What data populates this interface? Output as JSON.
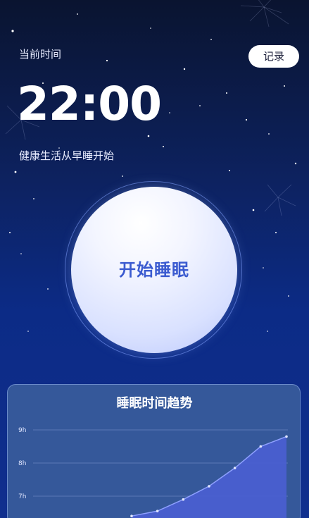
{
  "header": {
    "current_time_label": "当前时间",
    "record_button_label": "记录"
  },
  "clock": {
    "time": "22:00"
  },
  "slogan": "健康生活从早睡开始",
  "sleep_button_label": "开始睡眠",
  "trend": {
    "title": "睡眠时间趋势"
  },
  "chart_data": {
    "type": "area",
    "title": "睡眠时间趋势",
    "xlabel": "",
    "ylabel": "",
    "y_ticks": [
      "9h",
      "8h",
      "7h"
    ],
    "ylim": [
      6,
      9
    ],
    "x": [
      1,
      2,
      3,
      4,
      5,
      6,
      7
    ],
    "values": [
      6.4,
      6.55,
      6.9,
      7.3,
      7.85,
      8.5,
      8.8
    ],
    "grid": true,
    "colors": {
      "fill": "#4a5fd0",
      "line": "#8ea0ff",
      "point": "#dfe5ff"
    }
  }
}
